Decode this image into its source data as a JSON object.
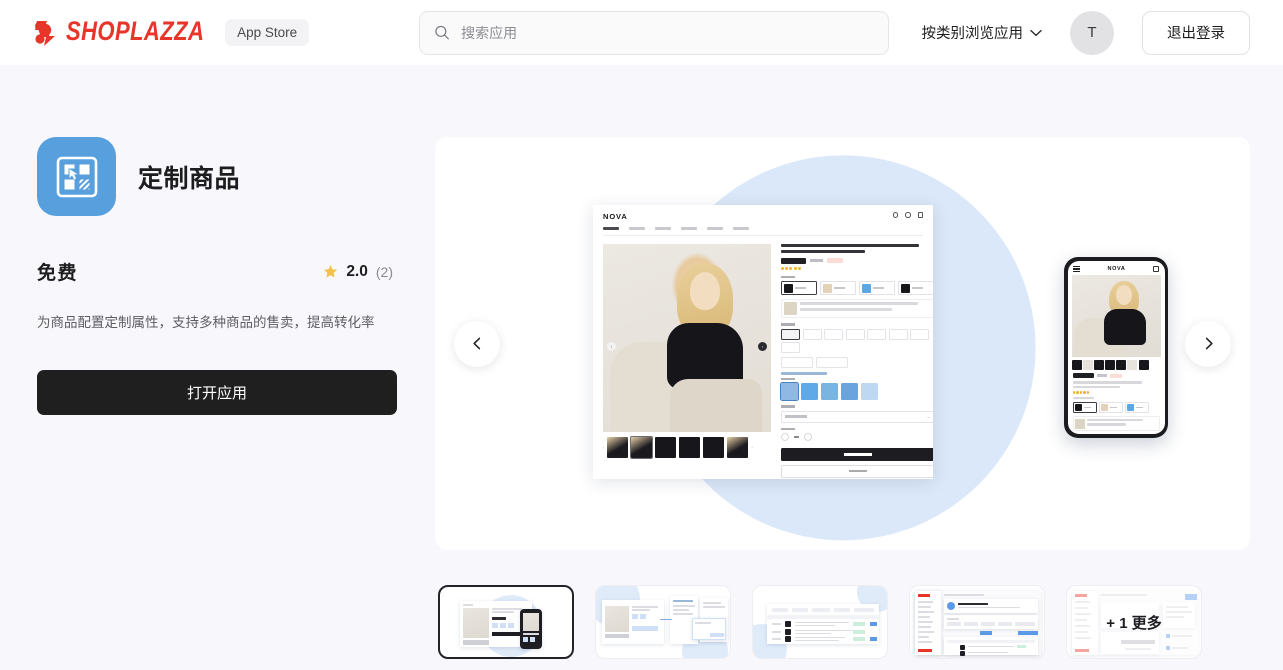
{
  "header": {
    "logo_text": "SHOPLAZZA",
    "logo_icon": "shoplazza-logo-mark",
    "store_badge": "App Store",
    "search": {
      "placeholder": "搜索应用",
      "value": "",
      "icon": "search-icon"
    },
    "category_dropdown": {
      "label": "按类别浏览应用",
      "icon": "chevron-down-icon"
    },
    "avatar_initial": "T",
    "logout_label": "退出登录"
  },
  "app": {
    "icon_name": "custom-product-app-icon",
    "icon_bg_color": "#57a0dd",
    "title": "定制商品",
    "price_label": "免费",
    "rating": {
      "icon": "star-icon",
      "star_color": "#f2c14a",
      "value": "2.0",
      "count": "(2)"
    },
    "description": "为商品配置定制属性，支持多种商品的售卖，提高转化率",
    "open_button_label": "打开应用",
    "open_button_color": "#1f1f20"
  },
  "carousel": {
    "prev_icon": "chevron-left-icon",
    "next_icon": "chevron-right-icon",
    "accent_circle_color": "#dbe8f9",
    "preview": {
      "store_brand": "NOVA",
      "mobile_brand": "NOVA"
    },
    "thumbnails": [
      {
        "name": "thumbnail-1-product-page",
        "selected": true,
        "kind": "desktop-phone",
        "overlay": ""
      },
      {
        "name": "thumbnail-2-editor-flow",
        "selected": false,
        "kind": "flow",
        "overlay": ""
      },
      {
        "name": "thumbnail-3-list-table",
        "selected": false,
        "kind": "table",
        "overlay": ""
      },
      {
        "name": "thumbnail-4-admin-orders",
        "selected": false,
        "kind": "admin",
        "overlay": ""
      },
      {
        "name": "thumbnail-5-more",
        "selected": false,
        "kind": "admin-form",
        "overlay": "+ 1 更多"
      }
    ]
  },
  "colors": {
    "page_bg": "#f8f8fc",
    "header_bg": "#ffffff",
    "brand_red": "#e8352a",
    "text_primary": "#1d1d1f",
    "text_muted": "#8a8a91"
  }
}
